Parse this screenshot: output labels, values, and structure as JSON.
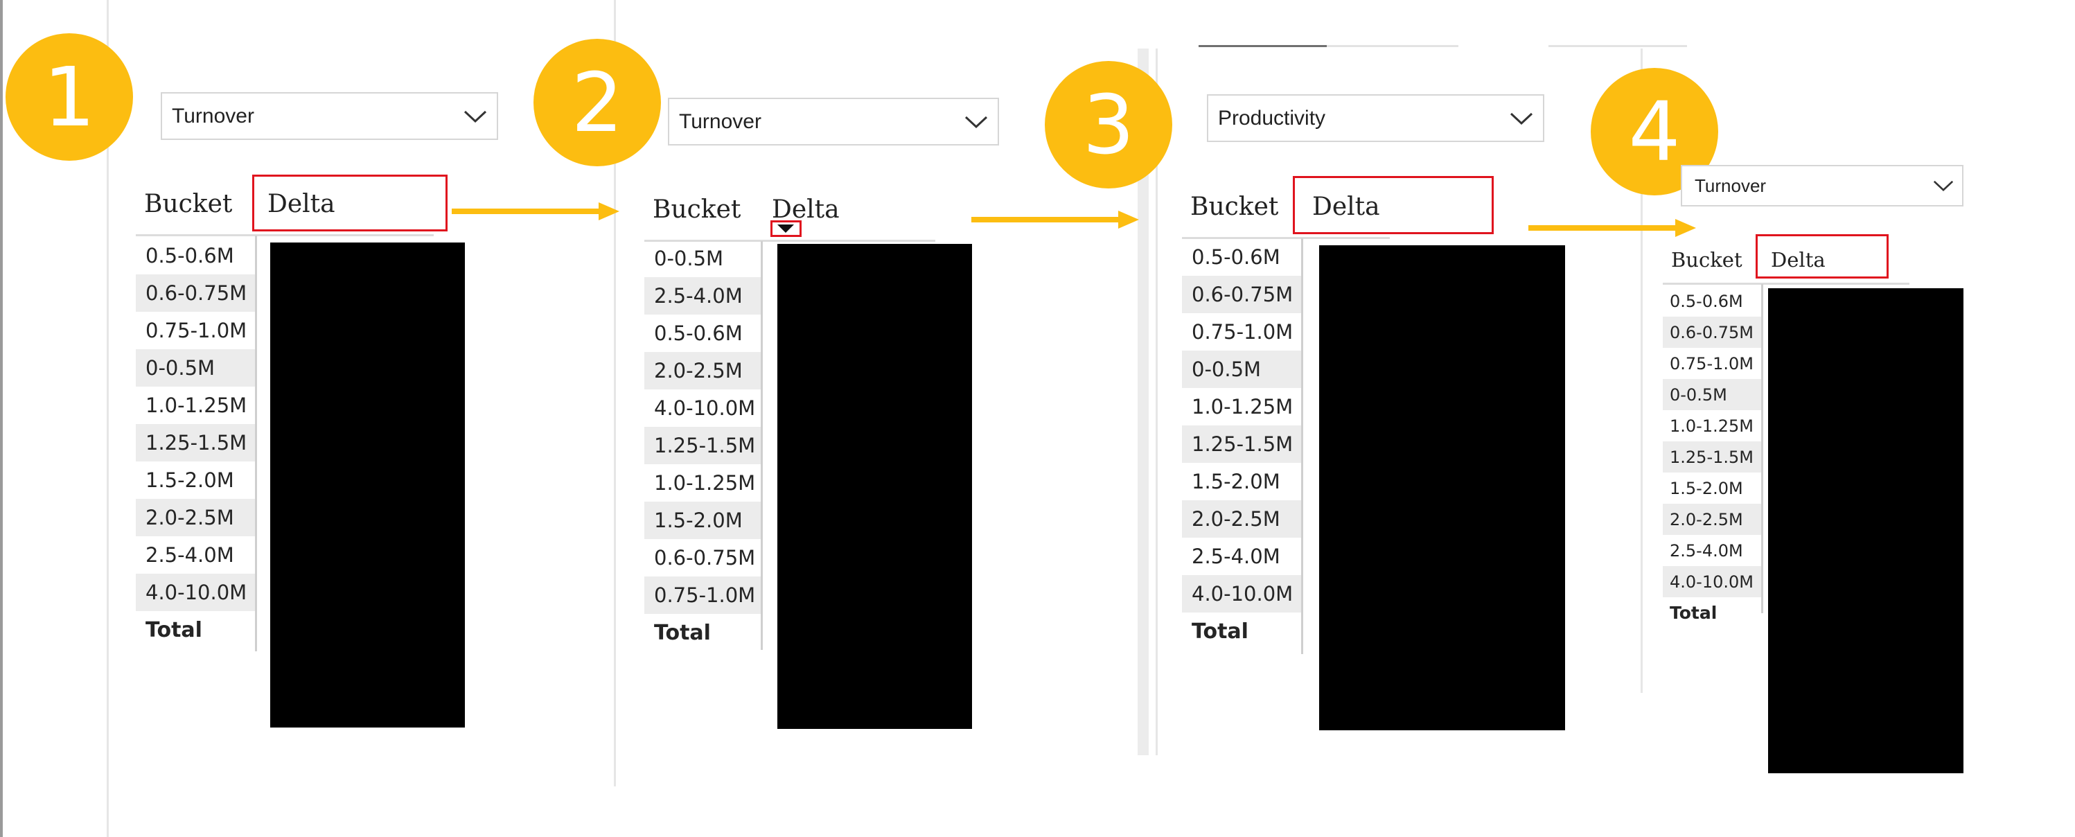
{
  "steps": [
    {
      "badge": "1",
      "dropdown_value": "Turnover",
      "header_bucket": "Bucket",
      "header_delta": "Delta",
      "rows": [
        "0.5-0.6M",
        "0.6-0.75M",
        "0.75-1.0M",
        "0-0.5M",
        "1.0-1.25M",
        "1.25-1.5M",
        "1.5-2.0M",
        "2.0-2.5M",
        "2.5-4.0M",
        "4.0-10.0M"
      ],
      "total_label": "Total"
    },
    {
      "badge": "2",
      "dropdown_value": "Turnover",
      "header_bucket": "Bucket",
      "header_delta": "Delta",
      "rows": [
        "0-0.5M",
        "2.5-4.0M",
        "0.5-0.6M",
        "2.0-2.5M",
        "4.0-10.0M",
        "1.25-1.5M",
        "1.0-1.25M",
        "1.5-2.0M",
        "0.6-0.75M",
        "0.75-1.0M"
      ],
      "total_label": "Total"
    },
    {
      "badge": "3",
      "dropdown_value": "Productivity",
      "header_bucket": "Bucket",
      "header_delta": "Delta",
      "rows": [
        "0.5-0.6M",
        "0.6-0.75M",
        "0.75-1.0M",
        "0-0.5M",
        "1.0-1.25M",
        "1.25-1.5M",
        "1.5-2.0M",
        "2.0-2.5M",
        "2.5-4.0M",
        "4.0-10.0M"
      ],
      "total_label": "Total"
    },
    {
      "badge": "4",
      "dropdown_value": "Turnover",
      "header_bucket": "Bucket",
      "header_delta": "Delta",
      "rows": [
        "0.5-0.6M",
        "0.6-0.75M",
        "0.75-1.0M",
        "0-0.5M",
        "1.0-1.25M",
        "1.25-1.5M",
        "1.5-2.0M",
        "2.0-2.5M",
        "2.5-4.0M",
        "4.0-10.0M"
      ],
      "total_label": "Total"
    }
  ],
  "colors": {
    "badge": "#fcbd11",
    "arrow": "#fcbd11",
    "highlight_box": "#e0141e",
    "row_alt": "#ececec",
    "redaction": "#000000"
  },
  "icons": {
    "dropdown": "chevron-down-icon",
    "sort": "sort-descending-icon",
    "arrow": "right-arrow-icon"
  }
}
